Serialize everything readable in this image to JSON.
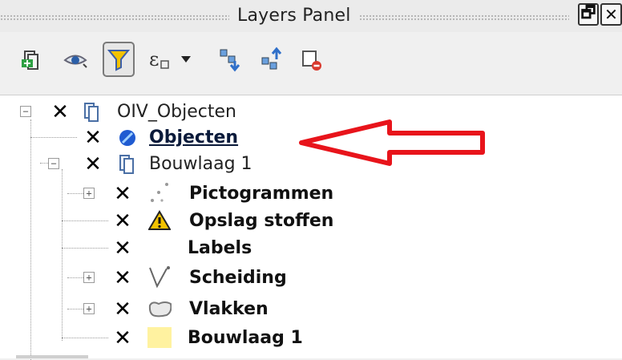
{
  "panel": {
    "title": "Layers Panel",
    "float_button": "🗗",
    "close_button": "✕"
  },
  "toolbar": {
    "buttons": [
      {
        "icon": "add-group-icon"
      },
      {
        "icon": "visibility-eye-icon"
      },
      {
        "icon": "filter-icon",
        "active": true
      },
      {
        "icon": "expression-filter-icon"
      },
      {
        "icon": "dropdown-arrow-icon"
      },
      {
        "icon": "expand-all-icon"
      },
      {
        "icon": "collapse-all-icon"
      },
      {
        "icon": "remove-layer-icon"
      }
    ]
  },
  "tree": {
    "check_mark": "✕",
    "expand_minus": "−",
    "expand_plus": "+",
    "items": [
      {
        "label": "OIV_Objecten",
        "type": "group",
        "expanded": true,
        "checked": true
      },
      {
        "label": "Objecten",
        "type": "layer",
        "checked": true,
        "selected": true
      },
      {
        "label": "Bouwlaag 1",
        "type": "group",
        "expanded": true,
        "checked": true
      },
      {
        "label": "Pictogrammen",
        "type": "layer",
        "checked": true
      },
      {
        "label": "Opslag stoffen",
        "type": "layer",
        "checked": true
      },
      {
        "label": "Labels",
        "type": "layer",
        "checked": true
      },
      {
        "label": "Scheiding",
        "type": "layer",
        "checked": true
      },
      {
        "label": "Vlakken",
        "type": "layer",
        "checked": true
      },
      {
        "label": "Bouwlaag 1",
        "type": "layer",
        "checked": true
      }
    ]
  },
  "colors": {
    "annotation_arrow": "#e8141b",
    "fill_swatch": "#fff2a0",
    "warning_yellow": "#f2c200",
    "point_blue": "#1f5bd1"
  }
}
